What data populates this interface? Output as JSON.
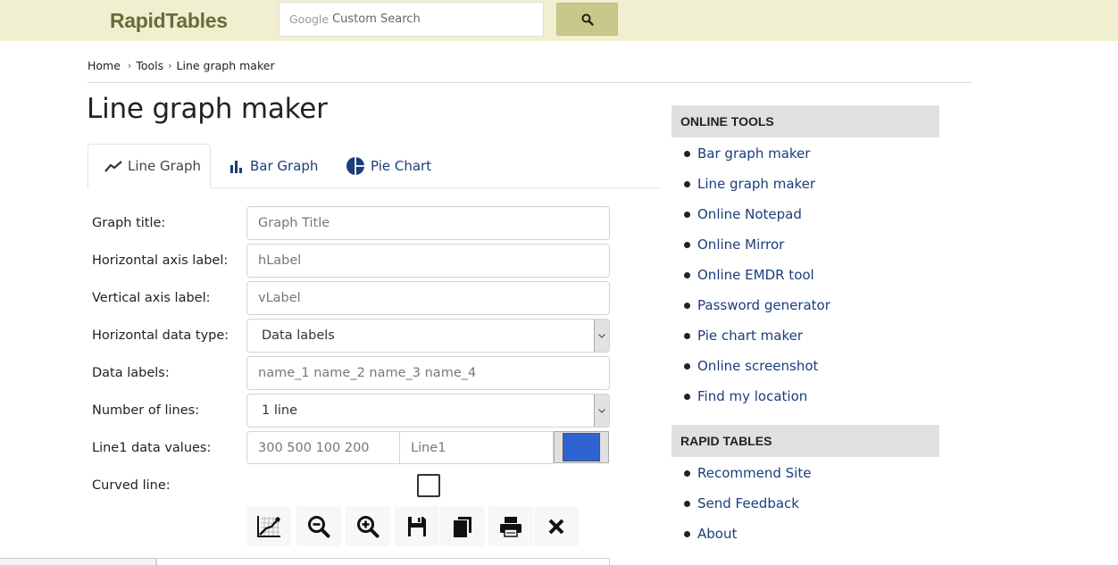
{
  "header": {
    "logo": "RapidTables",
    "search": {
      "brand": "Google",
      "placeholder": "Custom Search"
    },
    "search_button_icon": "search-icon"
  },
  "breadcrumb": [
    "Home",
    "Tools",
    "Line graph maker"
  ],
  "page_title": "Line graph maker",
  "tabs": [
    {
      "label": "Line Graph",
      "icon": "line-chart-icon",
      "active": true
    },
    {
      "label": "Bar Graph",
      "icon": "bar-chart-icon",
      "active": false
    },
    {
      "label": "Pie Chart",
      "icon": "pie-chart-icon",
      "active": false
    }
  ],
  "form": {
    "graph_title": {
      "label": "Graph title:",
      "placeholder": "Graph Title",
      "value": ""
    },
    "h_axis": {
      "label": "Horizontal axis label:",
      "placeholder": "hLabel",
      "value": ""
    },
    "v_axis": {
      "label": "Vertical axis label:",
      "placeholder": "vLabel",
      "value": ""
    },
    "h_data_type": {
      "label": "Horizontal data type:",
      "selected": "Data labels"
    },
    "data_labels": {
      "label": "Data labels:",
      "placeholder": "name_1 name_2 name_3 name_4",
      "value": ""
    },
    "num_lines": {
      "label": "Number of lines:",
      "selected": "1 line"
    },
    "line1": {
      "label": "Line1 data values:",
      "values_placeholder": "300 500 100 200",
      "name_placeholder": "Line1",
      "color": "#2f63d1"
    },
    "curved": {
      "label": "Curved line:",
      "checked": false
    }
  },
  "toolbar": [
    {
      "name": "draw-graph-button",
      "icon": "chart-icon"
    },
    {
      "name": "zoom-out-button",
      "icon": "zoom-out-icon"
    },
    {
      "name": "zoom-in-button",
      "icon": "zoom-in-icon"
    },
    {
      "name": "save-button",
      "icon": "save-icon"
    },
    {
      "name": "copy-button",
      "icon": "copy-icon"
    },
    {
      "name": "print-button",
      "icon": "print-icon"
    },
    {
      "name": "clear-button",
      "icon": "close-icon"
    }
  ],
  "sidebar": {
    "online_tools": {
      "heading": "ONLINE TOOLS",
      "items": [
        "Bar graph maker",
        "Line graph maker",
        "Online Notepad",
        "Online Mirror",
        "Online EMDR tool",
        "Password generator",
        "Pie chart maker",
        "Online screenshot",
        "Find my location"
      ]
    },
    "rapid_tables": {
      "heading": "RAPID TABLES",
      "items": [
        "Recommend Site",
        "Send Feedback",
        "About"
      ]
    }
  }
}
